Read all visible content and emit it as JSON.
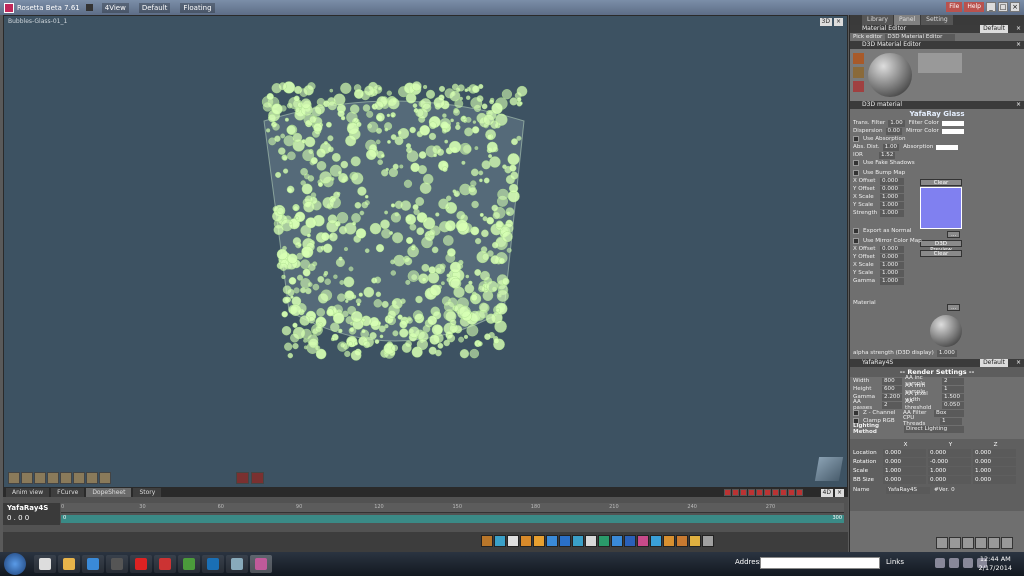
{
  "window": {
    "title": "Rosetta Beta 7.61",
    "menus": [
      "4View",
      "Default",
      "Floating"
    ],
    "right_menus": [
      "File",
      "Help"
    ]
  },
  "viewport": {
    "label": "Bubbles-Glass-01_1",
    "mode": "3D"
  },
  "timeline": {
    "tabs": [
      "Anim view",
      "FCurve",
      "DopeSheet",
      "Story"
    ],
    "active_tab": "DopeSheet",
    "mode": "4D",
    "object_name": "YafaRay4S",
    "time": "0 . 0 0",
    "ticks": [
      "0",
      "30",
      "60",
      "90",
      "120",
      "150",
      "180",
      "210",
      "240",
      "270"
    ],
    "start_frame": "0",
    "end_frame": "300"
  },
  "panel": {
    "tabs": [
      "Library",
      "Panel",
      "Setting"
    ],
    "active_tab": "Panel",
    "material_editor": {
      "header": "Material Editor",
      "default_btn": "Default",
      "pick_label": "Pick editor",
      "pick_value": "D3D Material Editor"
    },
    "d3d_editor": {
      "header": "D3D Material Editor"
    },
    "d3d_material": {
      "header": "D3D material",
      "title": "YafaRay Glass",
      "trans_filter_label": "Trans. Filter",
      "trans_filter": "1.00",
      "filter_color_label": "Filter Color",
      "dispersion_label": "Dispersion",
      "dispersion": "0.00",
      "mirror_color_label": "Mirror Color",
      "use_absorption": "Use Absorption",
      "abs_dist_label": "Abs. Dist.",
      "abs_dist": "1.00",
      "absorption_label": "Absorption",
      "ior_label": "IOR",
      "ior": "1.52",
      "use_fake_shadows": "Use Fake Shadows",
      "use_bump_map": "Use Bump Map",
      "clear": "Clear",
      "x_offset_label": "X Offset",
      "x_offset": "0.000",
      "y_offset_label": "Y Offset",
      "y_offset": "0.000",
      "x_scale_label": "X Scale",
      "x_scale": "1.000",
      "y_scale_label": "Y Scale",
      "y_scale": "1.000",
      "strength_label": "Strength",
      "strength": "1.000",
      "dots": "...",
      "export_as_normal": "Export as Normal",
      "d3d_preview": "D3D Preview",
      "use_mirror_color_map": "Use Mirror Color Map",
      "clear2": "Clear",
      "x_offset2": "0.000",
      "y_offset2": "0.000",
      "x_scale2": "1.000",
      "y_scale2": "1.000",
      "gamma_label": "Gamma",
      "gamma2": "1.000",
      "material_label": "Material",
      "alpha_label": "alpha strength (D3D display)",
      "alpha": "1.000"
    },
    "yafaray": {
      "header": "YafaRay4S",
      "default_btn": "Default",
      "title": "-- Render Settings --",
      "width_label": "Width",
      "width": "800",
      "aa_inc_label": "AA inc sample",
      "aa_inc": "2",
      "height_label": "Height",
      "height": "600",
      "aa_min_label": "AA min sample",
      "aa_min": "1",
      "gamma_label": "Gamma",
      "gamma": "2.200",
      "aa_pixel_label": "AA pixel width",
      "aa_pixel": "1.500",
      "aa_passes_label": "AA passes",
      "aa_passes": "2",
      "aa_threshold_label": "AA threshold",
      "aa_threshold": "0.050",
      "zchannel": "Z - Channel",
      "aa_filter_label": "AA Filter",
      "aa_filter": "Box",
      "clamp_rgb": "Clamp RGB",
      "cpu_threads_label": "CPU Threads",
      "cpu_threads": "1",
      "lighting_method_label": "Lighting Method",
      "lighting_method": "Direct Lighting"
    },
    "transform": {
      "axes": [
        "X",
        "Y",
        "Z"
      ],
      "rows": [
        {
          "label": "Location",
          "values": [
            "0.000",
            "0.000",
            "0.000"
          ]
        },
        {
          "label": "Rotation",
          "values": [
            "0.000",
            "-0.000",
            "0.000"
          ]
        },
        {
          "label": "Scale",
          "values": [
            "1.000",
            "1.000",
            "1.000"
          ]
        },
        {
          "label": "BB Size",
          "values": [
            "0.000",
            "0.000",
            "0.000"
          ]
        }
      ],
      "name_label": "Name",
      "name": "YafaRay4S",
      "ver_label": "#Ver.",
      "ver": "0"
    }
  },
  "taskbar": {
    "address_label": "Address",
    "links_label": "Links",
    "time": "12:44 AM",
    "date": "2/17/2014"
  }
}
